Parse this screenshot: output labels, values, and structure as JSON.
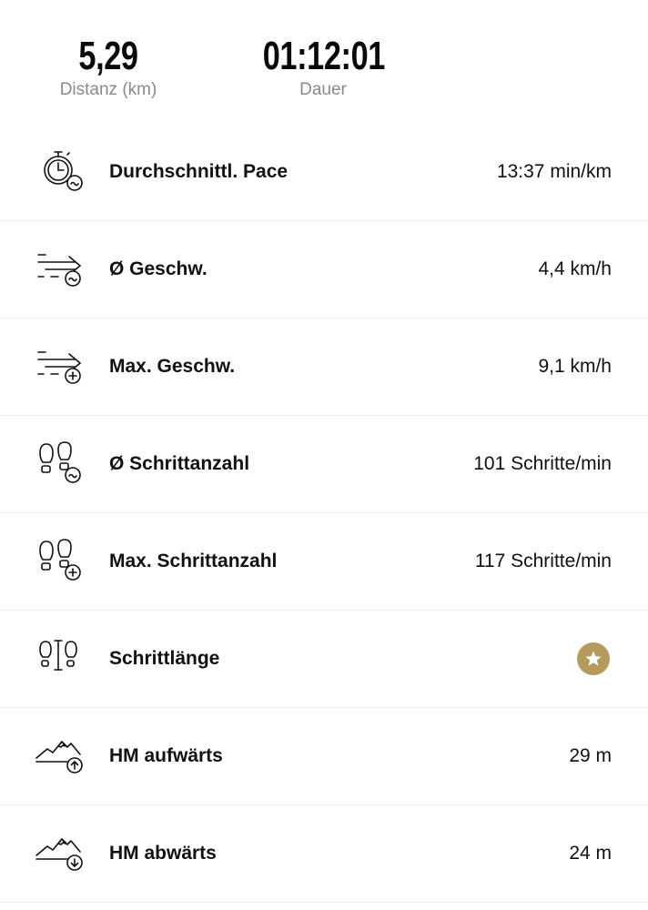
{
  "summary": {
    "distance_value": "5,29",
    "distance_label": "Distanz (km)",
    "duration_value": "01:12:01",
    "duration_label": "Dauer"
  },
  "rows": [
    {
      "icon": "stopwatch-icon",
      "label": "Durchschnittl. Pace",
      "value": "13:37 min/km"
    },
    {
      "icon": "speed-average-icon",
      "label": "Ø Geschw.",
      "value": "4,4 km/h"
    },
    {
      "icon": "speed-max-icon",
      "label": "Max. Geschw.",
      "value": "9,1 km/h"
    },
    {
      "icon": "footsteps-average-icon",
      "label": "Ø Schrittanzahl",
      "value": "101 Schritte/min"
    },
    {
      "icon": "footsteps-max-icon",
      "label": "Max. Schrittanzahl",
      "value": "117 Schritte/min"
    },
    {
      "icon": "stride-length-icon",
      "label": "Schrittlänge",
      "value_icon": "premium-star-icon"
    },
    {
      "icon": "mountain-up-icon",
      "label": "HM aufwärts",
      "value": "29 m"
    },
    {
      "icon": "mountain-down-icon",
      "label": "HM abwärts",
      "value": "24 m"
    }
  ],
  "colors": {
    "premium_badge": "#b59a5b",
    "label_gray": "#8a8a8a"
  }
}
